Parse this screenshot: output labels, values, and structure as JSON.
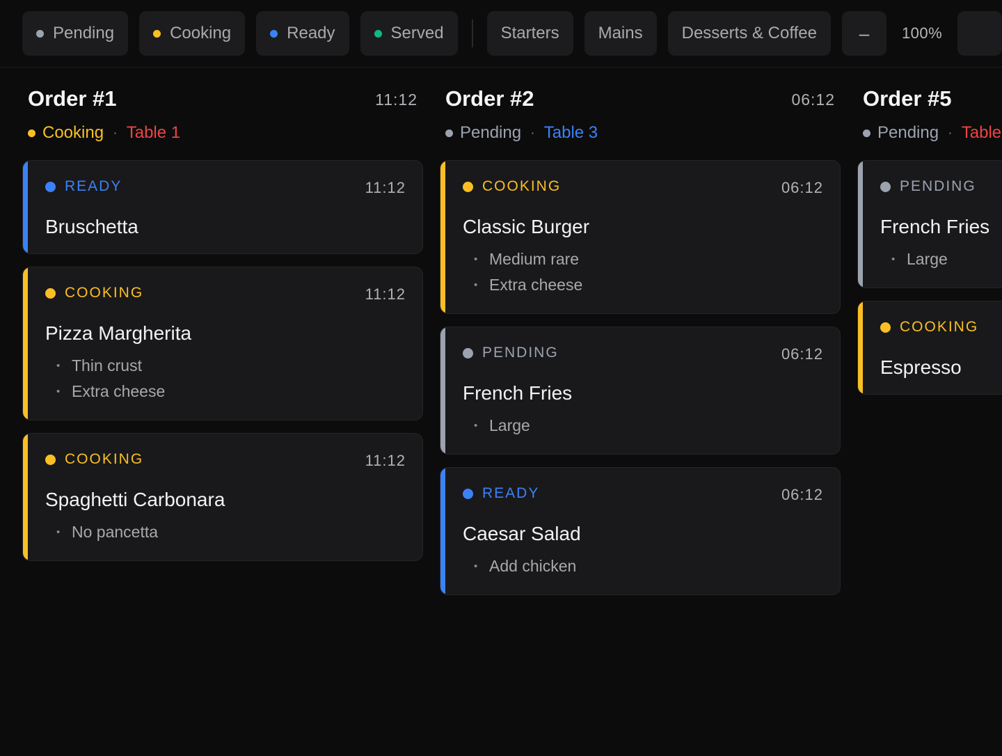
{
  "toolbar": {
    "status_filters": [
      {
        "label": "Pending",
        "color": "#9ca3af"
      },
      {
        "label": "Cooking",
        "color": "#fbbf24"
      },
      {
        "label": "Ready",
        "color": "#3b82f6"
      },
      {
        "label": "Served",
        "color": "#10b981"
      }
    ],
    "course_filters": [
      "Starters",
      "Mains",
      "Desserts & Coffee"
    ],
    "zoom_out_label": "–",
    "zoom_level": "100%"
  },
  "colors": {
    "pending": "#9ca3af",
    "cooking": "#fbbf24",
    "ready": "#3b82f6",
    "table_red": "#ef4444",
    "table_blue": "#3b82f6"
  },
  "orders": [
    {
      "title": "Order #1",
      "time": "11:12",
      "status": "Cooking",
      "status_color": "#fbbf24",
      "table": "Table 1",
      "table_color": "#ef4444",
      "items": [
        {
          "status": "READY",
          "color": "#3b82f6",
          "time": "11:12",
          "name": "Bruschetta",
          "mods": []
        },
        {
          "status": "COOKING",
          "color": "#fbbf24",
          "time": "11:12",
          "name": "Pizza Margherita",
          "mods": [
            "Thin crust",
            "Extra cheese"
          ]
        },
        {
          "status": "COOKING",
          "color": "#fbbf24",
          "time": "11:12",
          "name": "Spaghetti Carbonara",
          "mods": [
            "No pancetta"
          ]
        }
      ]
    },
    {
      "title": "Order #2",
      "time": "06:12",
      "status": "Pending",
      "status_color": "#9ca3af",
      "table": "Table 3",
      "table_color": "#3b82f6",
      "items": [
        {
          "status": "COOKING",
          "color": "#fbbf24",
          "time": "06:12",
          "name": "Classic Burger",
          "mods": [
            "Medium rare",
            "Extra cheese"
          ]
        },
        {
          "status": "PENDING",
          "color": "#9ca3af",
          "time": "06:12",
          "name": "French Fries",
          "mods": [
            "Large"
          ]
        },
        {
          "status": "READY",
          "color": "#3b82f6",
          "time": "06:12",
          "name": "Caesar Salad",
          "mods": [
            "Add chicken"
          ]
        }
      ]
    },
    {
      "title": "Order #5",
      "time": "",
      "status": "Pending",
      "status_color": "#9ca3af",
      "table": "Table",
      "table_color": "#ef4444",
      "items": [
        {
          "status": "PENDING",
          "color": "#9ca3af",
          "time": "",
          "name": "French Fries",
          "mods": [
            "Large"
          ]
        },
        {
          "status": "COOKING",
          "color": "#fbbf24",
          "time": "",
          "name": "Espresso",
          "mods": []
        }
      ]
    }
  ]
}
